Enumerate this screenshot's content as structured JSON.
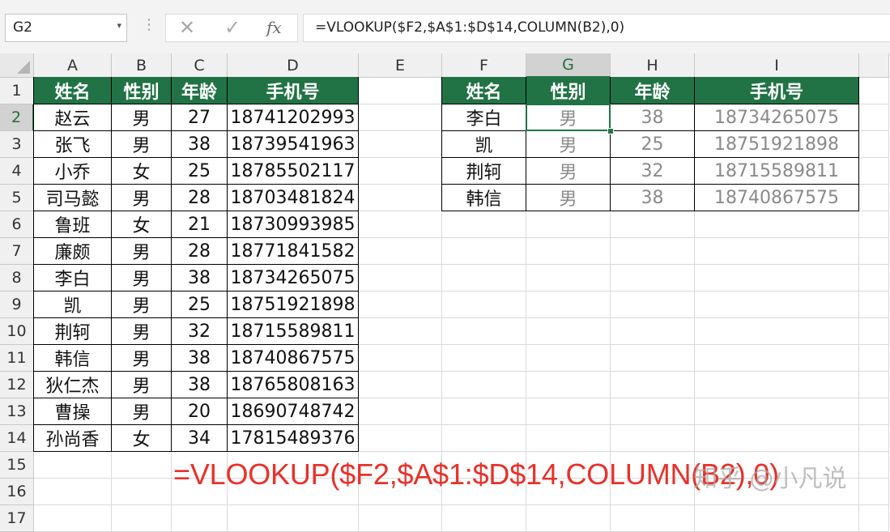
{
  "name_box": {
    "value": "G2",
    "dropdown_icon": "chevron-down-icon"
  },
  "formula_bar": {
    "cancel_icon": "✕",
    "enter_icon": "✓",
    "fx_label": "fx",
    "formula": "=VLOOKUP($F2,$A$1:$D$14,COLUMN(B2),0)"
  },
  "active_cell": "G2",
  "columns": [
    "A",
    "B",
    "C",
    "D",
    "E",
    "F",
    "G",
    "H",
    "I"
  ],
  "rows": [
    "1",
    "2",
    "3",
    "4",
    "5",
    "6",
    "7",
    "8",
    "9",
    "10",
    "11",
    "12",
    "13",
    "14",
    "15",
    "16",
    "17"
  ],
  "source_table": {
    "headers": [
      "姓名",
      "性别",
      "年龄",
      "手机号"
    ],
    "rows": [
      [
        "赵云",
        "男",
        "27",
        "18741202993"
      ],
      [
        "张飞",
        "男",
        "38",
        "18739541963"
      ],
      [
        "小乔",
        "女",
        "25",
        "18785502117"
      ],
      [
        "司马懿",
        "男",
        "28",
        "18703481824"
      ],
      [
        "鲁班",
        "女",
        "21",
        "18730993985"
      ],
      [
        "廉颇",
        "男",
        "28",
        "18771841582"
      ],
      [
        "李白",
        "男",
        "38",
        "18734265075"
      ],
      [
        "凯",
        "男",
        "25",
        "18751921898"
      ],
      [
        "荆轲",
        "男",
        "32",
        "18715589811"
      ],
      [
        "韩信",
        "男",
        "38",
        "18740867575"
      ],
      [
        "狄仁杰",
        "男",
        "38",
        "18765808163"
      ],
      [
        "曹操",
        "男",
        "20",
        "18690748742"
      ],
      [
        "孙尚香",
        "女",
        "34",
        "17815489376"
      ]
    ]
  },
  "lookup_table": {
    "headers": [
      "姓名",
      "性别",
      "年龄",
      "手机号"
    ],
    "rows": [
      [
        "李白",
        "男",
        "38",
        "18734265075"
      ],
      [
        "凯",
        "男",
        "25",
        "18751921898"
      ],
      [
        "荆轲",
        "男",
        "32",
        "18715589811"
      ],
      [
        "韩信",
        "男",
        "38",
        "18740867575"
      ]
    ]
  },
  "overlay_formula": "=VLOOKUP($F2,$A$1:$D$14,COLUMN(B2),0)",
  "watermark": "知乎 @小凡说",
  "colors": {
    "header_bg": "#217346",
    "overlay_text": "#e8312a",
    "result_text": "#8a8a8a"
  }
}
